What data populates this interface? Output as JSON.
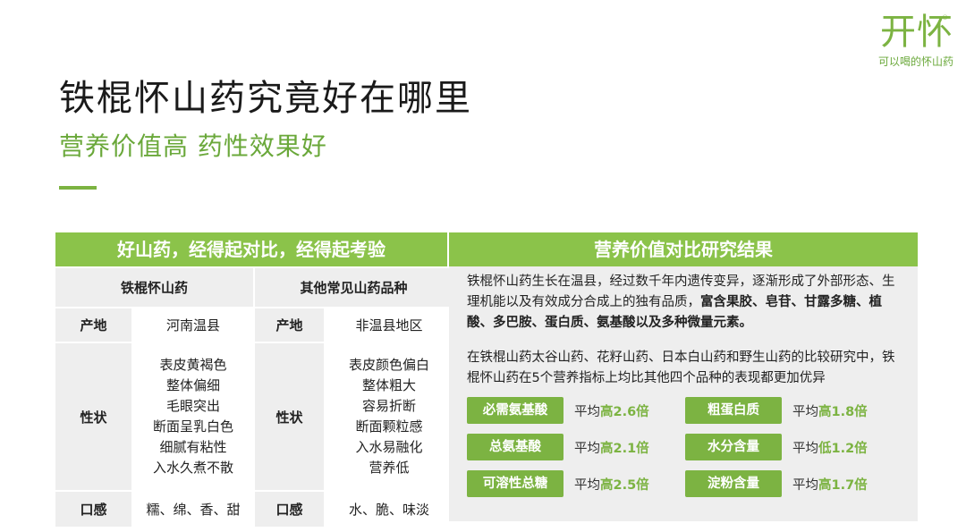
{
  "brand": {
    "logo_text": "开怀",
    "registered": "®",
    "tagline": "可以喝的怀山药"
  },
  "title": "铁棍怀山药究竟好在哪里",
  "subtitle": "营养价值高  药性效果好",
  "left_panel": {
    "header": "好山药，经得起对比，经得起考验",
    "col1_title": "铁棍怀山药",
    "col2_title": "其他常见山药品种",
    "rows": [
      {
        "label": "产地",
        "a_label": "产地",
        "a": [
          "河南温县"
        ],
        "b_label": "产地",
        "b": [
          "非温县地区"
        ]
      },
      {
        "label": "性状",
        "a": [
          "表皮黄褐色",
          "整体偏细",
          "毛眼突出",
          "断面呈乳白色",
          "细腻有粘性",
          "入水久煮不散"
        ],
        "b": [
          "表皮颜色偏白",
          "整体粗大",
          "容易折断",
          "断面颗粒感",
          "入水易融化",
          "营养低"
        ]
      },
      {
        "label": "口感",
        "a": [
          "糯、绵、香、甜"
        ],
        "b": [
          "水、脆、味淡"
        ]
      }
    ]
  },
  "right_panel": {
    "header": "营养价值对比研究结果",
    "para1_normal": "铁棍怀山药生长在温县，经过数千年内遗传变异，逐渐形成了外部形态、生理机能以及有效成分合成上的独有品质，",
    "para1_bold": "富含果胶、皂苷、甘露多糖、植酸、多巴胺、蛋白质、氨基酸以及多种微量元素。",
    "para2": "在铁棍山药太谷山药、花籽山药、日本白山药和野生山药的比较研究中，铁棍怀山药在5个营养指标上均比其他四个品种的表现都更加优异",
    "metrics": [
      {
        "name": "必需氨基酸",
        "prefix": "平均",
        "value": "高2.6倍"
      },
      {
        "name": "粗蛋白质",
        "prefix": "平均",
        "value": "高1.8倍"
      },
      {
        "name": "总氨基酸",
        "prefix": "平均",
        "value": "高2.1倍"
      },
      {
        "name": "水分含量",
        "prefix": "平均",
        "value": "低1.2倍"
      },
      {
        "name": "可溶性总糖",
        "prefix": "平均",
        "value": "高2.5倍"
      },
      {
        "name": "淀粉含量",
        "prefix": "平均",
        "value": "高1.7倍"
      }
    ]
  },
  "colors": {
    "accent": "#7cb342",
    "header_bg": "#8bc34a",
    "panel_bg": "#eeeeee"
  }
}
